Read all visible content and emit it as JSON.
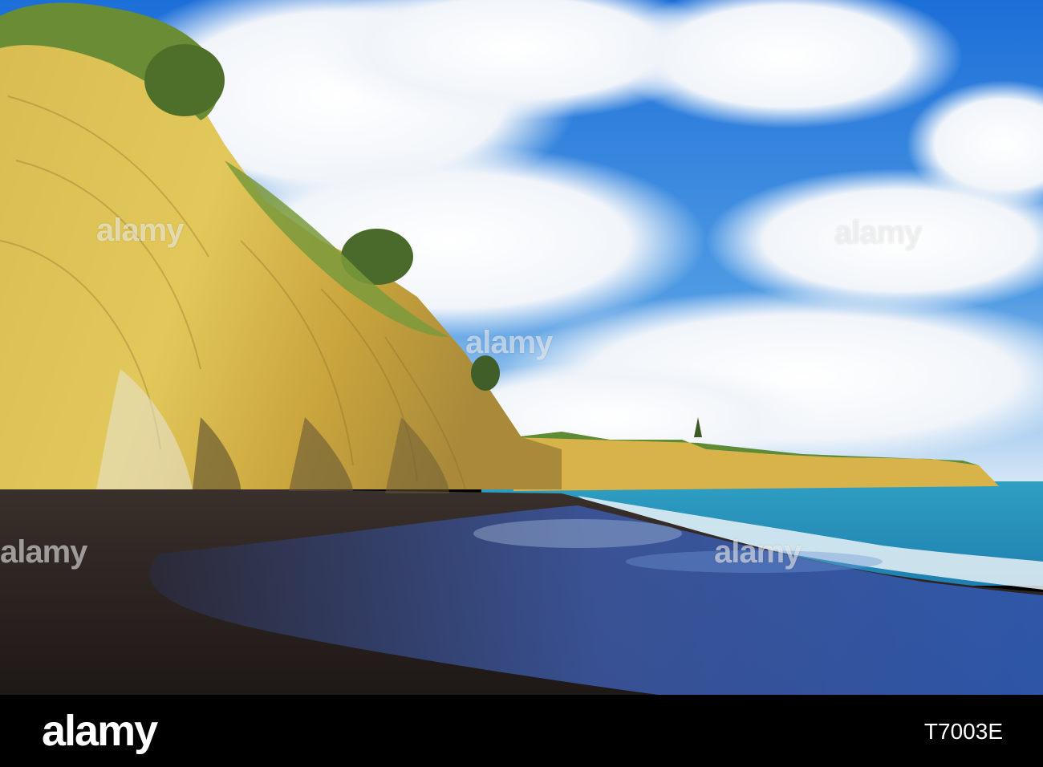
{
  "image": {
    "description_tags": [
      "sandstone-cliff",
      "black-sand-beach",
      "ocean",
      "cloudy-sky"
    ],
    "colors": {
      "sky": "#1f6fd1",
      "cloud": "#f4f7fb",
      "cliff": "#d9b84a",
      "cliff_shadow": "#7d6a38",
      "vegetation": "#5b7a2e",
      "sea": "#2aa0c0",
      "sand": "#2a2220",
      "wet_sand": "#3a5fa8"
    }
  },
  "watermarks": {
    "text": "alamy"
  },
  "footer": {
    "logo": "alamy",
    "image_id": "T7003E"
  }
}
